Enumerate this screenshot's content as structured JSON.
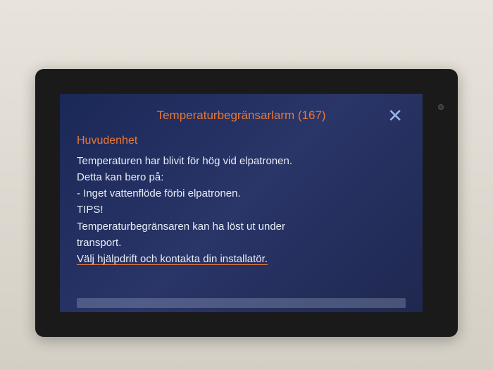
{
  "alarm": {
    "title": "Temperaturbegränsarlarm (167)",
    "subtitle": "Huvudenhet",
    "lines": {
      "l1": "Temperaturen har blivit för hög vid elpatronen.",
      "l2": "Detta kan bero på:",
      "l3": "- Inget vattenflöde förbi elpatronen.",
      "l4": "TIPS!",
      "l5": "Temperaturbegränsaren kan ha löst ut under",
      "l6": "transport.",
      "l7": "Välj hjälpdrift och kontakta din installatör."
    }
  },
  "colors": {
    "accent": "#e67838",
    "text": "#e8edf7",
    "bg_dark": "#1a2857"
  }
}
